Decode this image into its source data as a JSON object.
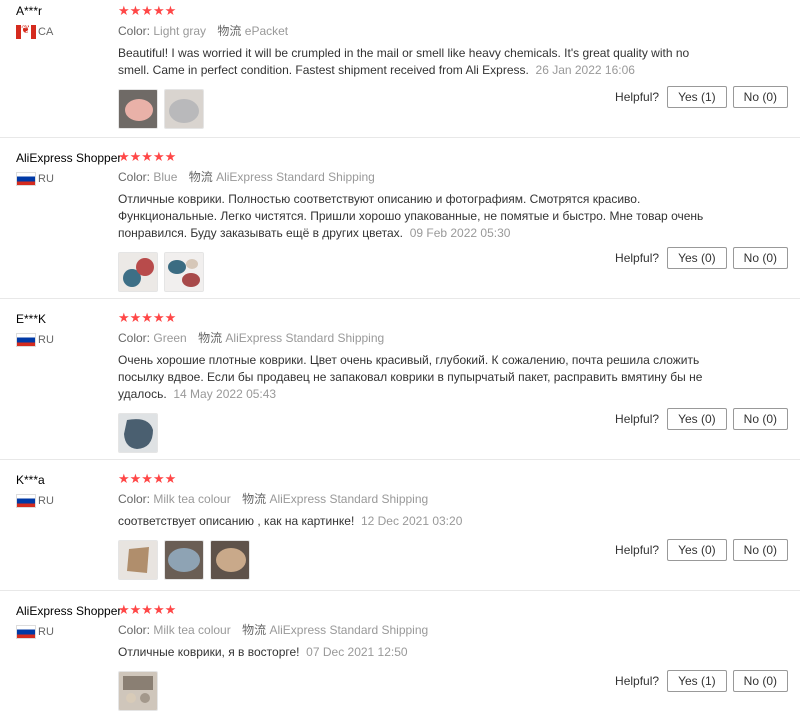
{
  "labels": {
    "color": "Color:",
    "shipping": "物流",
    "helpful": "Helpful?"
  },
  "reviews": [
    {
      "name": "A***r",
      "country": "CA",
      "stars": "★★★★★",
      "color": "Light gray",
      "shipping": "ePacket",
      "text": "Beautiful! I was worried it will be crumpled in the mail or smell like heavy chemicals. It's great quality with no smell. Came in perfect condition. Fastest shipment received from Ali Express.",
      "date": "26 Jan 2022 16:06",
      "yes": "Yes (1)",
      "no": "No (0)"
    },
    {
      "name": "AliExpress Shopper",
      "country": "RU",
      "stars": "★★★★★",
      "color": "Blue",
      "shipping": "AliExpress Standard Shipping",
      "text": "Отличные коврики. Полностью соответствуют описанию и фотографиям. Смотрятся красиво. Функциональные. Легко чистятся. Пришли хорошо упакованные, не помятые и быстро. Мне товар очень понравился. Буду заказывать ещё в других цветах.",
      "date": "09 Feb 2022 05:30",
      "yes": "Yes (0)",
      "no": "No (0)"
    },
    {
      "name": "E***K",
      "country": "RU",
      "stars": "★★★★★",
      "color": "Green",
      "shipping": "AliExpress Standard Shipping",
      "text": "Очень хорошие плотные коврики. Цвет очень красивый, глубокий. К сожалению, почта решила сложить посылку вдвое. Если бы продавец не запаковал коврики в пупырчатый пакет, расправить вмятину бы не удалось.",
      "date": "14 May 2022 05:43",
      "yes": "Yes (0)",
      "no": "No (0)"
    },
    {
      "name": "K***a",
      "country": "RU",
      "stars": "★★★★★",
      "color": "Milk tea colour",
      "shipping": "AliExpress Standard Shipping",
      "text": "соответствует описанию , как на картинке!",
      "date": "12 Dec 2021 03:20",
      "yes": "Yes (0)",
      "no": "No (0)"
    },
    {
      "name": "AliExpress Shopper",
      "country": "RU",
      "stars": "★★★★★",
      "color": "Milk tea colour",
      "shipping": "AliExpress Standard Shipping",
      "text": "Отличные коврики, я в восторге!",
      "date": "07 Dec 2021 12:50",
      "yes": "Yes (1)",
      "no": "No (0)"
    }
  ]
}
